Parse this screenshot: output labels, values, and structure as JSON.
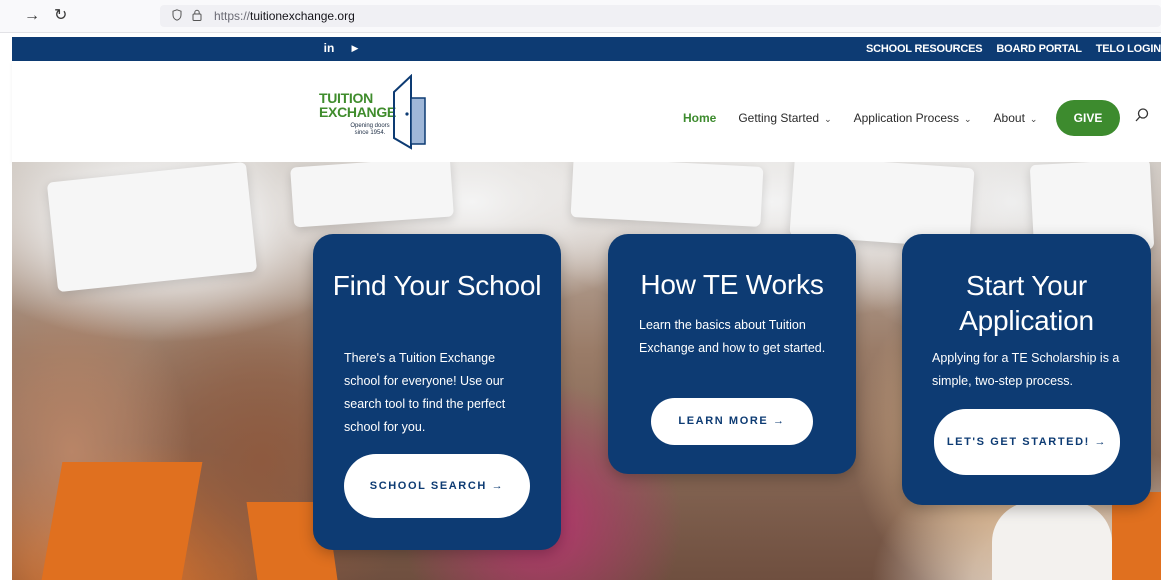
{
  "browser": {
    "forward_icon": "arrow-right-icon",
    "reload_icon": "reload-icon",
    "url_scheme": "https://",
    "url_host": "tuitionexchange.org"
  },
  "topbar": {
    "social": [
      "in",
      "▶"
    ],
    "links": [
      "SCHOOL RESOURCES",
      "BOARD PORTAL",
      "TELO LOGIN"
    ]
  },
  "logo": {
    "line1": "TUITION",
    "line2": "EXCHANGE",
    "tagline": "Opening doors since 1954."
  },
  "nav": {
    "home": "Home",
    "getting_started": "Getting Started",
    "application_process": "Application Process",
    "about": "About",
    "give": "GIVE"
  },
  "cards": [
    {
      "title": "Find Your School",
      "text": "There's a Tuition Exchange school for everyone! Use our search tool to find the perfect school for you.",
      "button": "SCHOOL SEARCH →"
    },
    {
      "title": "How TE Works",
      "text": "Learn the basics about Tuition Exchange and how to get started.",
      "button": "LEARN MORE →"
    },
    {
      "title": "Start Your Application",
      "text": "Applying for a TE Scholarship is a simple, two-step process.",
      "button": "LET'S GET STARTED! →"
    }
  ],
  "colors": {
    "brand_navy": "#0d3b73",
    "brand_green": "#3d8b2e"
  }
}
